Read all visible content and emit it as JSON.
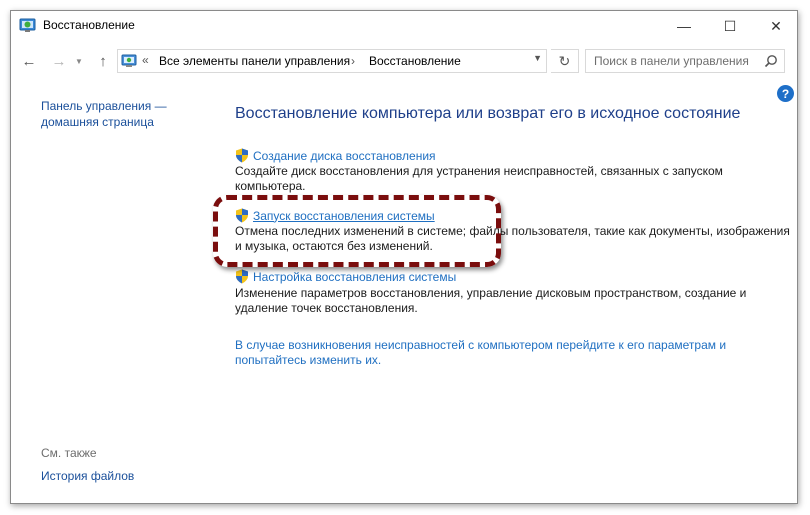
{
  "window": {
    "title": "Восстановление",
    "controls": {
      "minimize": "—",
      "maximize": "☐",
      "close": "✕"
    }
  },
  "navigation": {
    "back": "←",
    "forward": "→",
    "up": "↑",
    "address": {
      "chevron": "«",
      "segments": [
        "Все элементы панели управления",
        "Восстановление"
      ],
      "separator": "›"
    },
    "refresh": "↻",
    "search": {
      "placeholder": "Поиск в панели управления"
    }
  },
  "help": {
    "label": "?"
  },
  "sidebar": {
    "home_link": "Панель управления — домашняя страница",
    "see_also_label": "См. также",
    "see_also_items": [
      "История файлов"
    ]
  },
  "main": {
    "title": "Восстановление компьютера или возврат его в исходное состояние",
    "items": [
      {
        "link": "Создание диска восстановления",
        "description": "Создайте диск восстановления для устранения неисправностей, связанных с запуском компьютера."
      },
      {
        "link": "Запуск восстановления системы",
        "description": "Отмена последних изменений в системе; файлы пользователя, такие как документы, изображения и музыка, остаются без изменений."
      },
      {
        "link": "Настройка восстановления системы",
        "description": "Изменение параметров восстановления, управление дисковым пространством, создание и удаление точек восстановления."
      }
    ],
    "footer_link": "В случае возникновения неисправностей с компьютером перейдите к его параметрам и попытайтесь изменить их."
  },
  "colors": {
    "link": "#1f6fc1",
    "title": "#1e3f8a",
    "highlight": "#7a0d0d"
  }
}
